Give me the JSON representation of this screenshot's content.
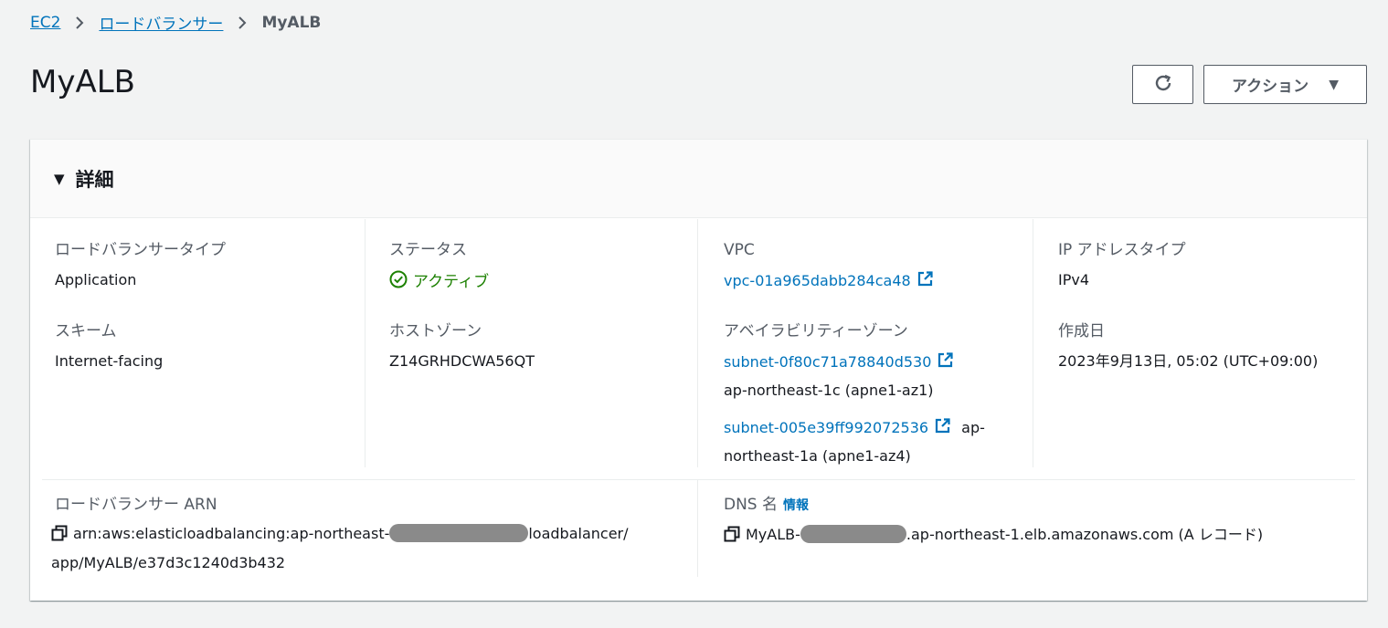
{
  "breadcrumb": {
    "items": [
      "EC2",
      "ロードバランサー"
    ],
    "current": "MyALB"
  },
  "page": {
    "title": "MyALB",
    "actions_label": "アクション"
  },
  "details": {
    "title": "詳細",
    "lb_type_label": "ロードバランサータイプ",
    "lb_type_value": "Application",
    "scheme_label": "スキーム",
    "scheme_value": "Internet-facing",
    "status_label": "ステータス",
    "status_value": "アクティブ",
    "hosted_zone_label": "ホストゾーン",
    "hosted_zone_value": "Z14GRHDCWA56QT",
    "vpc_label": "VPC",
    "vpc_value": "vpc-01a965dabb284ca48",
    "az_label": "アベイラビリティーゾーン",
    "subnets": [
      {
        "id": "subnet-0f80c71a78840d530",
        "az_line1": "",
        "az_line2": "ap-northeast-1c (apne1-az1)"
      },
      {
        "id": "subnet-005e39ff992072536",
        "az_line1": "ap-",
        "az_line2": "northeast-1a (apne1-az4)"
      }
    ],
    "ip_type_label": "IP アドレスタイプ",
    "ip_type_value": "IPv4",
    "created_label": "作成日",
    "created_value": "2023年9月13日, 05:02 (UTC+09:00)",
    "arn_label": "ロードバランサー ARN",
    "arn_part1": "arn:aws:elasticloadbalancing:ap-northeast-",
    "arn_part2": "loadbalancer/",
    "arn_line2": "app/MyALB/e37d3c1240d3b432",
    "dns_label": "DNS 名",
    "dns_info": "情報",
    "dns_part1": "MyALB-",
    "dns_part2": ".ap-northeast-1.elb.amazonaws.com (A レコード)"
  },
  "colors": {
    "link": "#0073bb",
    "status_ok": "#1d8102",
    "background": "#f2f3f3"
  }
}
